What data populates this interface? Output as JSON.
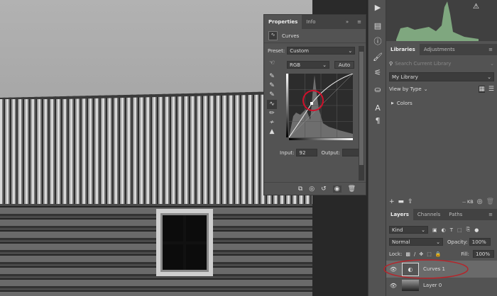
{
  "properties": {
    "tabs": [
      "Properties",
      "Info"
    ],
    "title": "Curves",
    "preset_label": "Preset:",
    "preset_value": "Custom",
    "channel": "RGB",
    "auto": "Auto",
    "input_label": "Input:",
    "input_value": "92",
    "output_label": "Output:",
    "output_value": ""
  },
  "libraries": {
    "tabs": [
      "Libraries",
      "Adjustments"
    ],
    "search_placeholder": "Search Current Library",
    "library": "My Library",
    "view_by": "View by Type",
    "colors": "Colors",
    "kb": "-- KB"
  },
  "layers": {
    "tabs": [
      "Layers",
      "Channels",
      "Paths"
    ],
    "filter": "Kind",
    "blend": "Normal",
    "opacity_label": "Opacity:",
    "opacity": "100%",
    "lock_label": "Lock:",
    "fill_label": "Fill:",
    "fill": "100%",
    "items": [
      {
        "name": "Curves 1"
      },
      {
        "name": "Layer 0"
      }
    ]
  },
  "colors": {
    "panel": "#535353",
    "highlight": "#c8102e",
    "histogram": "#7fa77f"
  }
}
